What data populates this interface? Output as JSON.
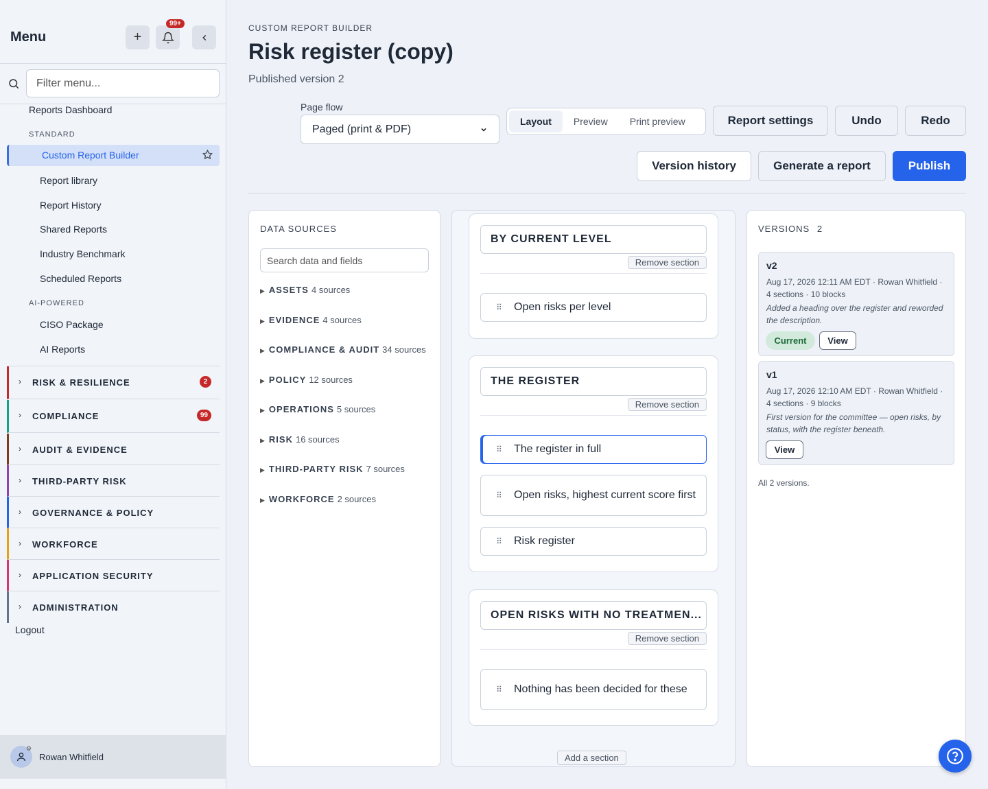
{
  "sidebar": {
    "title": "Menu",
    "notif_badge": "99+",
    "filter_placeholder": "Filter menu...",
    "top_link": "Reports Dashboard",
    "cat_standard": "STANDARD",
    "active_item": "Custom Report Builder",
    "standard_items": [
      "Report library",
      "Report History",
      "Shared Reports",
      "Industry Benchmark",
      "Scheduled Reports"
    ],
    "cat_ai": "AI-POWERED",
    "ai_items": [
      "CISO Package",
      "AI Reports"
    ],
    "groups": [
      {
        "label": "RISK & RESILIENCE",
        "badge": "2",
        "color": "#c62828"
      },
      {
        "label": "COMPLIANCE",
        "badge": "99",
        "color": "#16a085"
      },
      {
        "label": "AUDIT & EVIDENCE",
        "badge": "",
        "color": "#7a3e1d"
      },
      {
        "label": "THIRD-PARTY RISK",
        "badge": "",
        "color": "#8e44ad"
      },
      {
        "label": "GOVERNANCE & POLICY",
        "badge": "",
        "color": "#2563eb"
      },
      {
        "label": "WORKFORCE",
        "badge": "",
        "color": "#e6a117"
      },
      {
        "label": "APPLICATION SECURITY",
        "badge": "",
        "color": "#d6336c"
      },
      {
        "label": "ADMINISTRATION",
        "badge": "",
        "color": "#64748b"
      }
    ],
    "logout": "Logout",
    "user_name": "Rowan Whitfield"
  },
  "header": {
    "crumb": "CUSTOM REPORT BUILDER",
    "title": "Risk register (copy)",
    "subtitle": "Published version 2",
    "page_flow_label": "Page flow",
    "page_flow_value": "Paged (print & PDF)",
    "view_tabs": [
      "Layout",
      "Preview",
      "Print preview"
    ],
    "active_tab": "Layout",
    "report_settings": "Report settings",
    "undo": "Undo",
    "redo": "Redo",
    "version_history": "Version history",
    "generate": "Generate a report",
    "publish": "Publish"
  },
  "data_sources": {
    "title": "DATA SOURCES",
    "search_placeholder": "Search data and fields",
    "items": [
      {
        "name": "ASSETS",
        "count": "4 sources"
      },
      {
        "name": "EVIDENCE",
        "count": "4 sources"
      },
      {
        "name": "COMPLIANCE & AUDIT",
        "count": "34 sources"
      },
      {
        "name": "POLICY",
        "count": "12 sources"
      },
      {
        "name": "OPERATIONS",
        "count": "5 sources"
      },
      {
        "name": "RISK",
        "count": "16 sources"
      },
      {
        "name": "THIRD-PARTY RISK",
        "count": "7 sources"
      },
      {
        "name": "WORKFORCE",
        "count": "2 sources"
      }
    ]
  },
  "canvas": {
    "remove_label": "Remove section",
    "add_section": "Add a section",
    "sections": [
      {
        "heading": "BY CURRENT LEVEL",
        "blocks": [
          "Open risks per level"
        ]
      },
      {
        "heading": "THE REGISTER",
        "blocks": [
          "The register in full",
          "Open risks, highest current score first",
          "Risk register"
        ]
      },
      {
        "heading": "OPEN RISKS WITH NO TREATMEN...",
        "blocks": [
          "Nothing has been decided for these"
        ]
      }
    ]
  },
  "versions": {
    "title": "VERSIONS",
    "count": "2",
    "items": [
      {
        "tag": "v2",
        "meta1": "Aug 17, 2026 12:11 AM EDT · Rowan Whitfield ·",
        "meta2": "4 sections · 10 blocks",
        "note": "Added a heading over the register and reworded the description.",
        "current": "Current",
        "view": "View"
      },
      {
        "tag": "v1",
        "meta1": "Aug 17, 2026 12:10 AM EDT · Rowan Whitfield ·",
        "meta2": "4 sections · 9 blocks",
        "note": "First version for the committee — open risks, by status, with the register beneath.",
        "view": "View"
      }
    ],
    "footer": "All 2 versions."
  },
  "colors": {
    "primary": "#2563eb",
    "danger": "#c62828",
    "current_pill": "#d1eadb"
  }
}
